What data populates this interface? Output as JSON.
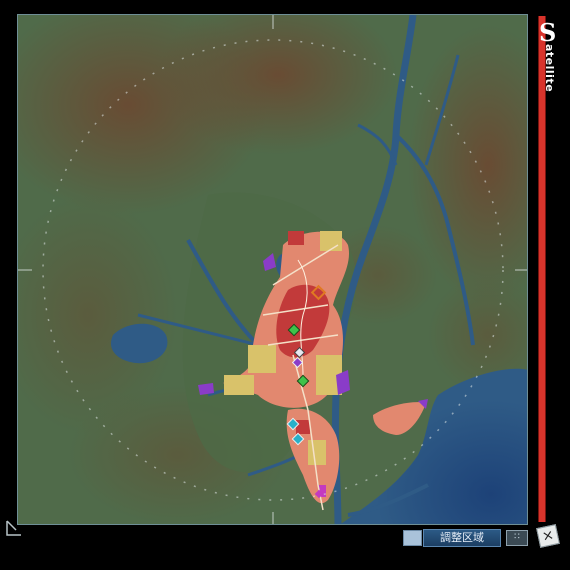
{
  "view": {
    "title_first_letter": "S",
    "title_rest": "atellite"
  },
  "legend": {
    "label": "調整区域",
    "swatch_color": "#a9c2da"
  },
  "controls": {
    "close_label": "×",
    "grid_button_label": "∷",
    "resize_icon": "resize-corner-icon"
  },
  "colors": {
    "terrain_low": "#4f6a48",
    "terrain_high": "#6a4a32",
    "water": "#2f5b86",
    "residential": "#e2886f",
    "commercial": "#c23a3a",
    "industrial": "#d9c26a",
    "park": "#7a9f50",
    "frame_accent": "#d8342c"
  },
  "map_markers": [
    {
      "name": "orange-diamond-marker",
      "color": "#e07a22"
    },
    {
      "name": "green-diamond-marker",
      "color": "#3ec24a"
    },
    {
      "name": "purple-diamond-marker",
      "color": "#8a3cc8"
    },
    {
      "name": "white-diamond-marker",
      "color": "#e8e8f0"
    },
    {
      "name": "green-diamond-marker-2",
      "color": "#3ec24a"
    },
    {
      "name": "cyan-diamond-marker",
      "color": "#2ab0c8"
    },
    {
      "name": "cyan-diamond-marker-2",
      "color": "#2ab0c8"
    },
    {
      "name": "magenta-diamond-marker",
      "color": "#c43ac0"
    }
  ]
}
